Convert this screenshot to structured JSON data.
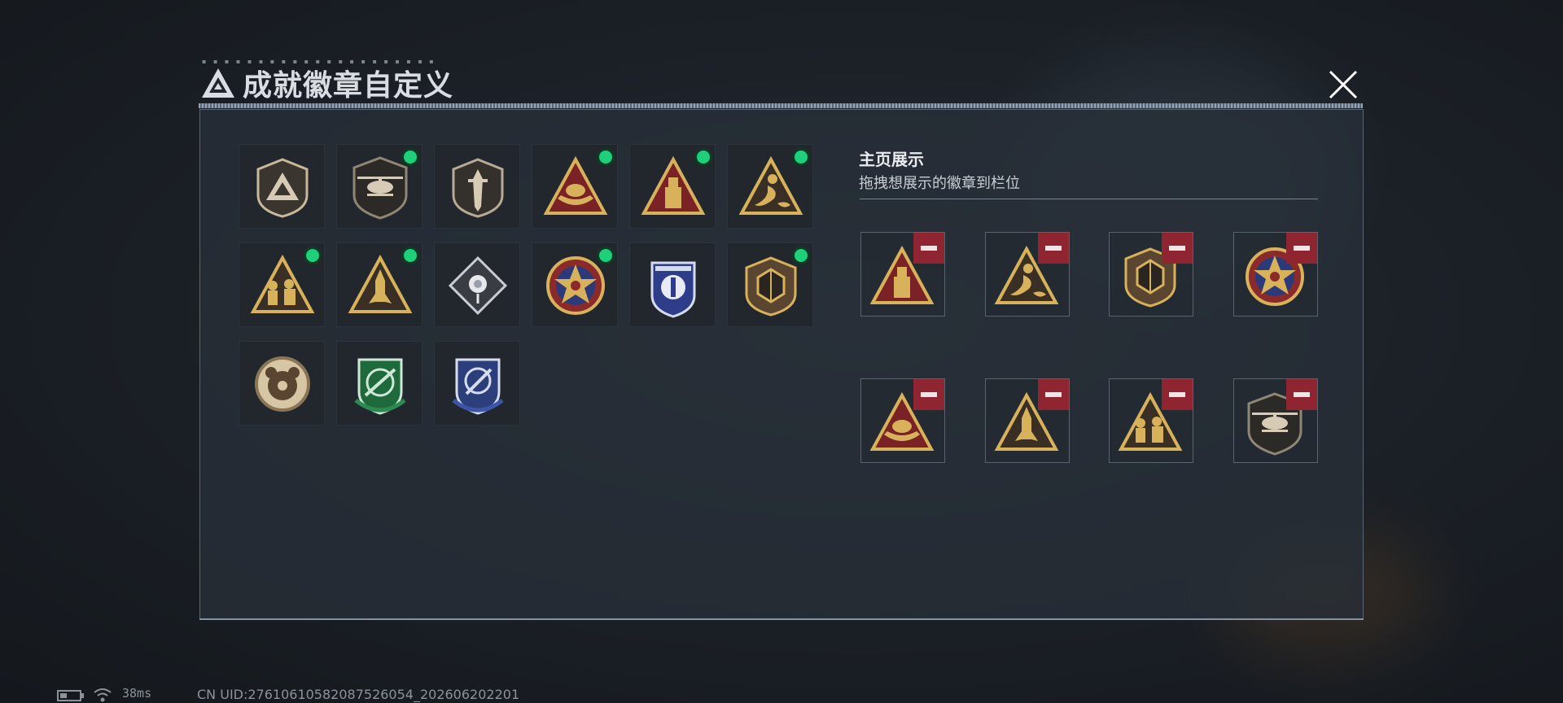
{
  "header": {
    "title": "成就徽章自定义",
    "logo_icon": "triangle-logo-icon",
    "close_icon": "close-icon"
  },
  "badges": [
    {
      "icon": "shield-triangle-badge-icon",
      "new": false
    },
    {
      "icon": "helicopter-badge-icon",
      "new": true
    },
    {
      "icon": "dagger-shield-badge-icon",
      "new": false
    },
    {
      "icon": "triangle-boat-badge-icon",
      "new": true
    },
    {
      "icon": "triangle-tower-badge-icon",
      "new": true
    },
    {
      "icon": "triangle-mermaid-badge-icon",
      "new": true
    },
    {
      "icon": "triangle-soldiers-badge-icon",
      "new": true
    },
    {
      "icon": "triangle-rocket-badge-icon",
      "new": true
    },
    {
      "icon": "diamond-rose-badge-icon",
      "new": false
    },
    {
      "icon": "star-roundel-badge-icon",
      "new": true
    },
    {
      "icon": "blue-police-shield-badge-icon",
      "new": false
    },
    {
      "icon": "shield-dice-badge-icon",
      "new": true
    },
    {
      "icon": "round-bear-badge-icon",
      "new": false
    },
    {
      "icon": "green-rifle-shield-badge-icon",
      "new": false
    },
    {
      "icon": "blue-knife-shield-badge-icon",
      "new": false
    }
  ],
  "showcase": {
    "title": "主页展示",
    "subtitle": "拖拽想展示的徽章到栏位",
    "remove_icon": "remove-icon",
    "slots": [
      {
        "icon": "triangle-tower-badge-icon"
      },
      {
        "icon": "triangle-mermaid-badge-icon"
      },
      {
        "icon": "shield-dice-badge-icon"
      },
      {
        "icon": "star-roundel-badge-icon"
      },
      {
        "icon": "triangle-boat-badge-icon"
      },
      {
        "icon": "triangle-rocket-badge-icon"
      },
      {
        "icon": "triangle-soldiers-badge-icon"
      },
      {
        "icon": "helicopter-badge-icon"
      }
    ]
  },
  "status_bar": {
    "battery_icon": "battery-icon",
    "wifi_icon": "wifi-icon",
    "ping": "38ms",
    "uid": "CN UID:27610610582087526054_202606202201"
  },
  "colors": {
    "new_dot": "#1fd07a",
    "remove": "#8f2530",
    "gold": "#d8b25a"
  }
}
